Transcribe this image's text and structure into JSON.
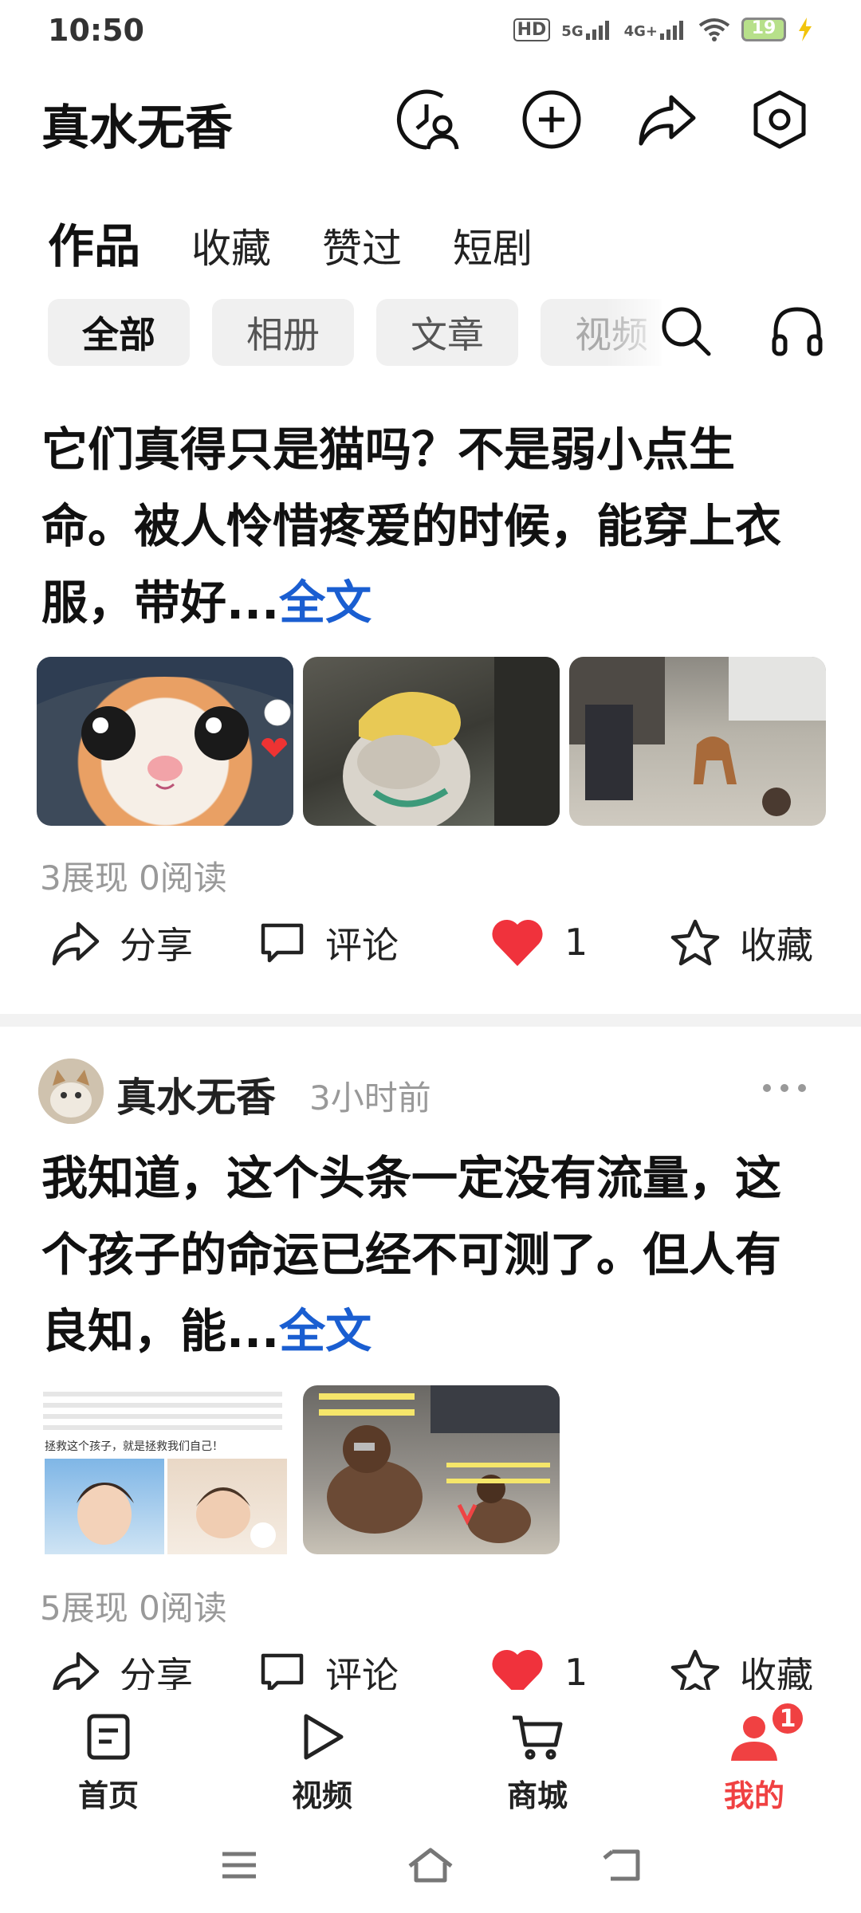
{
  "status_bar": {
    "time": "10:50",
    "hd_label": "HD",
    "net1": "5G",
    "net2": "4G+",
    "battery": "19"
  },
  "header": {
    "title": "真水无香",
    "icons": [
      "history-user-icon",
      "add-icon",
      "share-icon",
      "settings-icon"
    ]
  },
  "tabs": [
    {
      "label": "作品",
      "active": true
    },
    {
      "label": "收藏",
      "active": false
    },
    {
      "label": "赞过",
      "active": false
    },
    {
      "label": "短剧",
      "active": false
    }
  ],
  "filters": [
    {
      "label": "全部",
      "active": true
    },
    {
      "label": "相册",
      "active": false
    },
    {
      "label": "文章",
      "active": false
    },
    {
      "label": "视频",
      "active": false
    }
  ],
  "posts": [
    {
      "text": "它们真得只是猫吗？不是弱小点生命。被人怜惜疼爱的时候，能穿上衣服，带好...",
      "more_label": "全文",
      "stats": "3展现  0阅读",
      "actions": {
        "share": "分享",
        "comment": "评论",
        "likes": "1",
        "favorite": "收藏"
      }
    },
    {
      "author": "真水无香",
      "time": "3小时前",
      "text": "我知道，这个头条一定没有流量，这个孩子的命运已经不可测了。但人有良知，能...",
      "more_label": "全文",
      "image_caption": "拯救这个孩子，就是拯救我们自己！",
      "stats": "5展现  0阅读",
      "actions": {
        "share": "分享",
        "comment": "评论",
        "likes": "1",
        "favorite": "收藏"
      }
    }
  ],
  "bottom_nav": [
    {
      "label": "首页",
      "icon": "home-doc-icon",
      "active": false
    },
    {
      "label": "视频",
      "icon": "play-icon",
      "active": false
    },
    {
      "label": "商城",
      "icon": "cart-icon",
      "active": false
    },
    {
      "label": "我的",
      "icon": "user-icon",
      "active": true,
      "badge": "1"
    }
  ],
  "colors": {
    "accent_red": "#f04142",
    "link_blue": "#1a5ed1",
    "like_red": "#f0323c"
  }
}
